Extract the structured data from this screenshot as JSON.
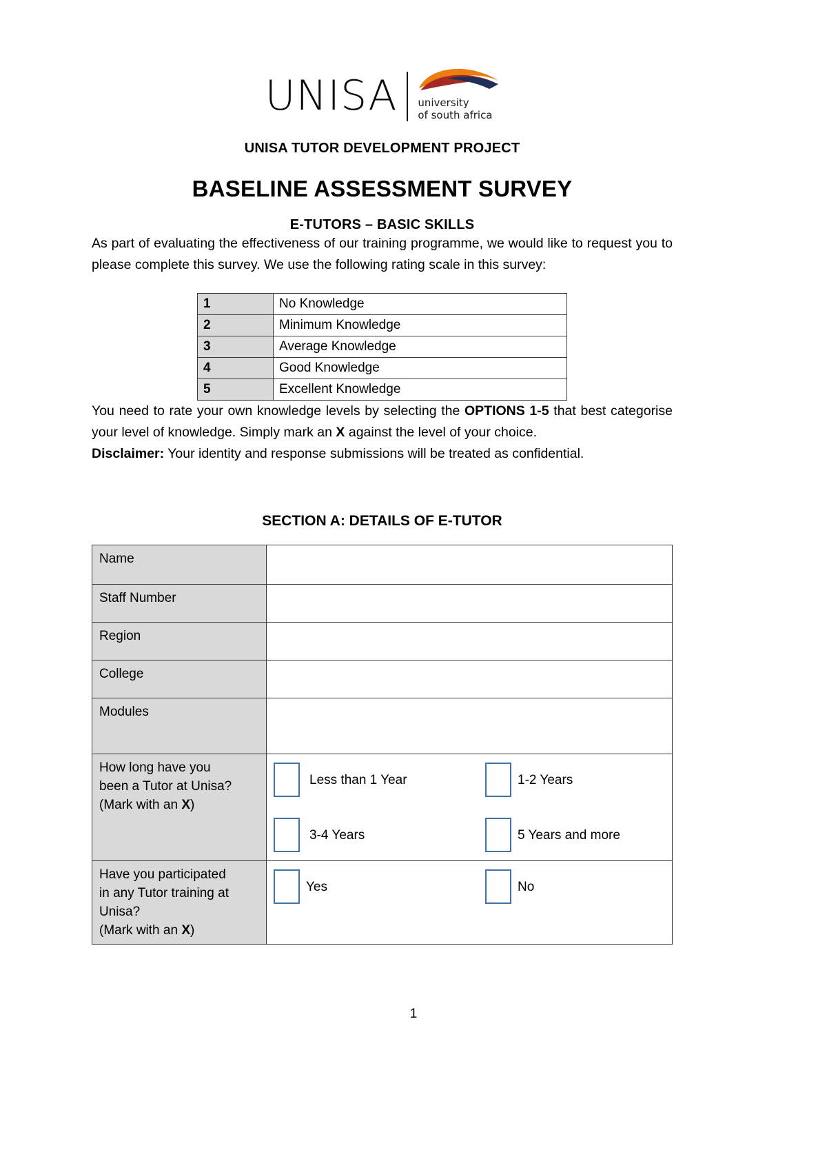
{
  "logo": {
    "wordmark": "UNISA",
    "tagline_line1": "university",
    "tagline_line2": "of south africa",
    "colors": {
      "orange": "#EE7D11",
      "dark_red": "#A32B24",
      "navy": "#1F3058"
    }
  },
  "header": {
    "project": "UNISA TUTOR DEVELOPMENT PROJECT",
    "title": "BASELINE ASSESSMENT SURVEY",
    "subtitle": "E-TUTORS – BASIC SKILLS"
  },
  "intro": {
    "paragraph": "As part of evaluating the effectiveness of our training programme, we would like to request you to please complete this survey. We use the following rating scale in this survey:"
  },
  "rating_scale": {
    "rows": [
      {
        "value": "1",
        "label": "No Knowledge"
      },
      {
        "value": "2",
        "label": "Minimum Knowledge"
      },
      {
        "value": "3",
        "label": "Average Knowledge"
      },
      {
        "value": "4",
        "label": "Good Knowledge"
      },
      {
        "value": "5",
        "label": "Excellent Knowledge"
      }
    ]
  },
  "instructions": {
    "part1": "You need to rate your own knowledge levels by selecting the ",
    "emphasis": "OPTIONS 1-5",
    "part2": " that best categorise your level of knowledge. Simply mark an ",
    "mark": "X",
    "part3": " against the level of your choice."
  },
  "disclaimer": {
    "label": "Disclaimer:",
    "text": " Your identity and response submissions will be treated as confidential."
  },
  "section_a": {
    "heading": "SECTION A: DETAILS OF E-TUTOR",
    "fields": [
      {
        "label": "Name",
        "value": ""
      },
      {
        "label": "Staff Number",
        "value": ""
      },
      {
        "label": "Region",
        "value": ""
      },
      {
        "label": "College",
        "value": ""
      },
      {
        "label": "Modules",
        "value": ""
      }
    ],
    "tenure_question": {
      "line1": "How long have you",
      "line2": "been a Tutor at Unisa?",
      "line3_pre": "(Mark with an ",
      "line3_mark": "X",
      "line3_post": ")",
      "options": [
        "Less than 1 Year",
        "1-2 Years",
        "3-4 Years",
        "5 Years and more"
      ]
    },
    "training_question": {
      "line1": "Have you participated",
      "line2": "in any Tutor training at",
      "line3": "Unisa?",
      "line4_pre": "(Mark with an ",
      "line4_mark": "X",
      "line4_post": ")",
      "options": [
        "Yes",
        "No"
      ]
    }
  },
  "footer": {
    "page_number": "1"
  }
}
